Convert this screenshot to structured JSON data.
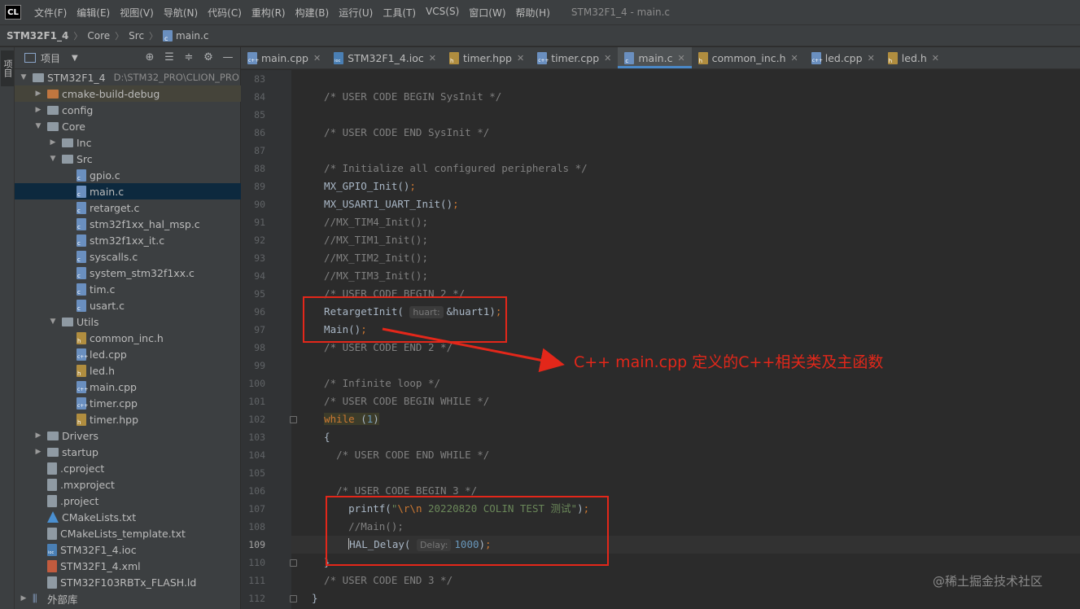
{
  "app_logo": "CL",
  "menu": [
    "文件(F)",
    "编辑(E)",
    "视图(V)",
    "导航(N)",
    "代码(C)",
    "重构(R)",
    "构建(B)",
    "运行(U)",
    "工具(T)",
    "VCS(S)",
    "窗口(W)",
    "帮助(H)"
  ],
  "window_title": "STM32F1_4 - main.c",
  "breadcrumb": [
    "STM32F1_4",
    "Core",
    "Src",
    "main.c"
  ],
  "tool_strip": {
    "project_label": "项目"
  },
  "project_panel": {
    "title": "项目",
    "tree": [
      {
        "label": "STM32F1_4",
        "path": "D:\\STM32_PRO\\CLION_PRO",
        "indent": 0,
        "arrow": "down",
        "icon": "folder-root-icon"
      },
      {
        "label": "cmake-build-debug",
        "indent": 1,
        "arrow": "right",
        "icon": "folder-orange-icon",
        "hl": true
      },
      {
        "label": "config",
        "indent": 1,
        "arrow": "right",
        "icon": "folder-icon"
      },
      {
        "label": "Core",
        "indent": 1,
        "arrow": "down",
        "icon": "folder-icon"
      },
      {
        "label": "Inc",
        "indent": 2,
        "arrow": "right",
        "icon": "folder-icon"
      },
      {
        "label": "Src",
        "indent": 2,
        "arrow": "down",
        "icon": "folder-icon"
      },
      {
        "label": "gpio.c",
        "indent": 3,
        "icon": "c-file-icon"
      },
      {
        "label": "main.c",
        "indent": 3,
        "icon": "c-file-icon",
        "selected": true
      },
      {
        "label": "retarget.c",
        "indent": 3,
        "icon": "c-file-icon"
      },
      {
        "label": "stm32f1xx_hal_msp.c",
        "indent": 3,
        "icon": "c-file-icon"
      },
      {
        "label": "stm32f1xx_it.c",
        "indent": 3,
        "icon": "c-file-icon"
      },
      {
        "label": "syscalls.c",
        "indent": 3,
        "icon": "c-file-icon"
      },
      {
        "label": "system_stm32f1xx.c",
        "indent": 3,
        "icon": "c-file-icon"
      },
      {
        "label": "tim.c",
        "indent": 3,
        "icon": "c-file-icon"
      },
      {
        "label": "usart.c",
        "indent": 3,
        "icon": "c-file-icon"
      },
      {
        "label": "Utils",
        "indent": 2,
        "arrow": "down",
        "icon": "folder-icon"
      },
      {
        "label": "common_inc.h",
        "indent": 3,
        "icon": "h-file-icon"
      },
      {
        "label": "led.cpp",
        "indent": 3,
        "icon": "cpp-file-icon"
      },
      {
        "label": "led.h",
        "indent": 3,
        "icon": "h-file-icon"
      },
      {
        "label": "main.cpp",
        "indent": 3,
        "icon": "cpp-file-icon"
      },
      {
        "label": "timer.cpp",
        "indent": 3,
        "icon": "cpp-file-icon"
      },
      {
        "label": "timer.hpp",
        "indent": 3,
        "icon": "h-file-icon"
      },
      {
        "label": "Drivers",
        "indent": 1,
        "arrow": "right",
        "icon": "folder-icon"
      },
      {
        "label": "startup",
        "indent": 1,
        "arrow": "right",
        "icon": "folder-icon"
      },
      {
        "label": ".cproject",
        "indent": 1,
        "icon": "generic-file-icon"
      },
      {
        "label": ".mxproject",
        "indent": 1,
        "icon": "generic-file-icon"
      },
      {
        "label": ".project",
        "indent": 1,
        "icon": "generic-file-icon"
      },
      {
        "label": "CMakeLists.txt",
        "indent": 1,
        "icon": "cmake-file-icon"
      },
      {
        "label": "CMakeLists_template.txt",
        "indent": 1,
        "icon": "generic-file-icon"
      },
      {
        "label": "STM32F1_4.ioc",
        "indent": 1,
        "icon": "ioc-file-icon"
      },
      {
        "label": "STM32F1_4.xml",
        "indent": 1,
        "icon": "xml-file-icon"
      },
      {
        "label": "STM32F103RBTx_FLASH.ld",
        "indent": 1,
        "icon": "generic-file-icon"
      },
      {
        "label": "外部库",
        "indent": 0,
        "arrow": "right",
        "icon": "library-icon"
      }
    ]
  },
  "tabs": [
    {
      "label": "main.cpp",
      "icon": "cpp-file-icon"
    },
    {
      "label": "STM32F1_4.ioc",
      "icon": "ioc-file-icon"
    },
    {
      "label": "timer.hpp",
      "icon": "h-file-icon"
    },
    {
      "label": "timer.cpp",
      "icon": "cpp-file-icon"
    },
    {
      "label": "main.c",
      "icon": "c-file-icon",
      "active": true
    },
    {
      "label": "common_inc.h",
      "icon": "h-file-icon"
    },
    {
      "label": "led.cpp",
      "icon": "cpp-file-icon"
    },
    {
      "label": "led.h",
      "icon": "h-file-icon"
    }
  ],
  "editor": {
    "current_line": 109,
    "lines": [
      {
        "n": 83,
        "code": [
          [
            "",
            "  "
          ]
        ]
      },
      {
        "n": 84,
        "code": [
          [
            "cmt",
            "  /* USER CODE BEGIN SysInit */"
          ]
        ]
      },
      {
        "n": 85,
        "code": []
      },
      {
        "n": 86,
        "code": [
          [
            "cmt",
            "  /* USER CODE END SysInit */"
          ]
        ]
      },
      {
        "n": 87,
        "code": []
      },
      {
        "n": 88,
        "code": [
          [
            "cmt",
            "  /* Initialize all configured peripherals */"
          ]
        ]
      },
      {
        "n": 89,
        "code": [
          [
            "fn",
            "  MX_GPIO_Init()"
          ],
          [
            "semi",
            ";"
          ]
        ]
      },
      {
        "n": 90,
        "code": [
          [
            "fn",
            "  MX_USART1_UART_Init()"
          ],
          [
            "semi",
            ";"
          ]
        ]
      },
      {
        "n": 91,
        "code": [
          [
            "cmt",
            "  //MX_TIM4_Init();"
          ]
        ]
      },
      {
        "n": 92,
        "code": [
          [
            "cmt",
            "  //MX_TIM1_Init();"
          ]
        ]
      },
      {
        "n": 93,
        "code": [
          [
            "cmt",
            "  //MX_TIM2_Init();"
          ]
        ]
      },
      {
        "n": 94,
        "code": [
          [
            "cmt",
            "  //MX_TIM3_Init();"
          ]
        ]
      },
      {
        "n": 95,
        "code": [
          [
            "cmt",
            "  /* USER CODE BEGIN 2 */"
          ]
        ]
      },
      {
        "n": 96,
        "code": [
          [
            "fn",
            "  RetargetInit( "
          ],
          [
            "hint",
            "huart:"
          ],
          [
            "fn",
            "&huart1)"
          ],
          [
            "semi",
            ";"
          ]
        ]
      },
      {
        "n": 97,
        "code": [
          [
            "fn",
            "  Main()"
          ],
          [
            "semi",
            ";"
          ]
        ]
      },
      {
        "n": 98,
        "code": [
          [
            "cmt",
            "  /* USER CODE END 2 */"
          ]
        ]
      },
      {
        "n": 99,
        "code": []
      },
      {
        "n": 100,
        "code": [
          [
            "cmt",
            "  /* Infinite loop */"
          ]
        ]
      },
      {
        "n": 101,
        "code": [
          [
            "cmt",
            "  /* USER CODE BEGIN WHILE */"
          ]
        ]
      },
      {
        "n": 102,
        "code": [
          [
            "",
            "  "
          ],
          [
            "kw-hl",
            "while"
          ],
          [
            "fn-hl",
            " ("
          ],
          [
            "num-hl",
            "1"
          ],
          [
            "fn-hl",
            ")"
          ]
        ]
      },
      {
        "n": 103,
        "code": [
          [
            "fn",
            "  {"
          ]
        ]
      },
      {
        "n": 104,
        "code": [
          [
            "cmt",
            "    /* USER CODE END WHILE */"
          ]
        ]
      },
      {
        "n": 105,
        "code": []
      },
      {
        "n": 106,
        "code": [
          [
            "cmt",
            "    /* USER CODE BEGIN 3 */"
          ]
        ]
      },
      {
        "n": 107,
        "code": [
          [
            "fn",
            "      printf("
          ],
          [
            "str",
            "\""
          ],
          [
            "esc",
            "\\r\\n"
          ],
          [
            "str",
            " 20220820 COLIN TEST 测试\""
          ],
          [
            "fn",
            ")"
          ],
          [
            "semi",
            ";"
          ]
        ]
      },
      {
        "n": 108,
        "code": [
          [
            "cmt",
            "      //Main();"
          ]
        ]
      },
      {
        "n": 109,
        "code": [
          [
            "",
            "      "
          ],
          [
            "caret",
            ""
          ],
          [
            "fn",
            "HAL_Delay( "
          ],
          [
            "hint",
            "Delay:"
          ],
          [
            "num",
            "1000"
          ],
          [
            "fn",
            ")"
          ],
          [
            "semi",
            ";"
          ]
        ]
      },
      {
        "n": 110,
        "code": [
          [
            "fn",
            "  }"
          ]
        ]
      },
      {
        "n": 111,
        "code": [
          [
            "cmt",
            "  /* USER CODE END 3 */"
          ]
        ]
      },
      {
        "n": 112,
        "code": [
          [
            "fn",
            "}"
          ]
        ]
      }
    ]
  },
  "annotation": {
    "text": "C++  main.cpp 定义的C++相关类及主函数",
    "color": "#e3271a"
  },
  "watermark": "@稀土掘金技术社区",
  "colors": {
    "background": "#2b2b2b",
    "panel": "#3c3f41",
    "selected_row": "#0d293e",
    "accent": "#4a88c7",
    "comment": "#808080",
    "keyword": "#cc7832",
    "number": "#6897bb",
    "string": "#6a8759"
  }
}
